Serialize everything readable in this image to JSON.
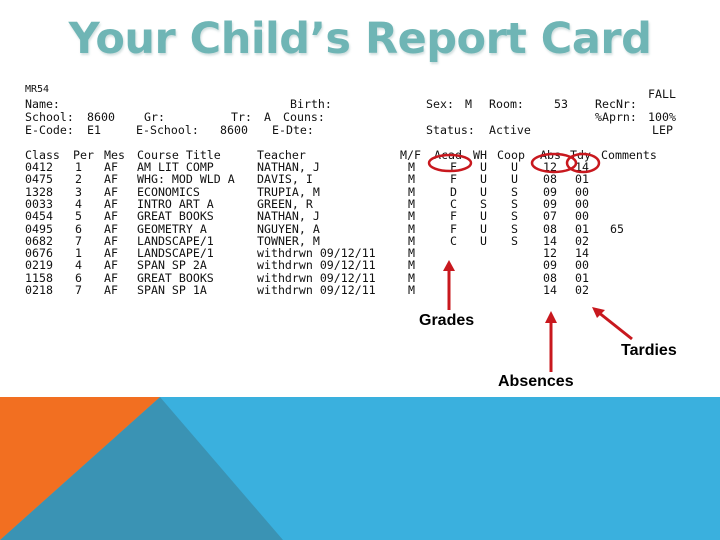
{
  "title": "Your Child’s Report Card",
  "header": {
    "record_id": "MR54",
    "term": "FALL",
    "name_label": "Name:",
    "birth_label": "Birth:",
    "sex_label": "Sex:",
    "sex_value": "M",
    "room_label": "Room:",
    "room_value": "53",
    "recnr_label": "RecNr:",
    "school_label": "School:",
    "school_value": "8600",
    "gr_label": "Gr:",
    "tr_label": "Tr:",
    "tr_value": "A",
    "couns_label": "Couns:",
    "aprn_label": "%Aprn:",
    "aprn_value": "100%",
    "ecode_label": "E-Code:",
    "ecode_value": "E1",
    "eschool_label": "E-School:",
    "eschool_value": "8600",
    "edte_label": "E-Dte:",
    "status_label": "Status:",
    "status_value": "Active",
    "lep": "LEP"
  },
  "table": {
    "columns": [
      "Class",
      "Per",
      "Mes",
      "Course Title",
      "Teacher",
      "M/F",
      "Acad",
      "WH",
      "Coop",
      "Abs",
      "Tdy",
      "Comments"
    ],
    "rows": [
      {
        "class": "0412",
        "per": "1",
        "mes": "AF",
        "course": "AM LIT COMP",
        "teacher": "NATHAN, J",
        "mf": "M",
        "acad": "F",
        "wh": "U",
        "coop": "U",
        "abs": "12",
        "tdy": "14",
        "comments": ""
      },
      {
        "class": "0475",
        "per": "2",
        "mes": "AF",
        "course": "WHG: MOD WLD A",
        "teacher": "DAVIS, I",
        "mf": "M",
        "acad": "F",
        "wh": "U",
        "coop": "U",
        "abs": "08",
        "tdy": "01",
        "comments": ""
      },
      {
        "class": "1328",
        "per": "3",
        "mes": "AF",
        "course": "ECONOMICS",
        "teacher": "TRUPIA, M",
        "mf": "M",
        "acad": "D",
        "wh": "U",
        "coop": "S",
        "abs": "09",
        "tdy": "00",
        "comments": ""
      },
      {
        "class": "0033",
        "per": "4",
        "mes": "AF",
        "course": "INTRO ART A",
        "teacher": "GREEN, R",
        "mf": "M",
        "acad": "C",
        "wh": "S",
        "coop": "S",
        "abs": "09",
        "tdy": "00",
        "comments": ""
      },
      {
        "class": "0454",
        "per": "5",
        "mes": "AF",
        "course": "GREAT BOOKS",
        "teacher": "NATHAN, J",
        "mf": "M",
        "acad": "F",
        "wh": "U",
        "coop": "S",
        "abs": "07",
        "tdy": "00",
        "comments": ""
      },
      {
        "class": "0495",
        "per": "6",
        "mes": "AF",
        "course": "GEOMETRY A",
        "teacher": "NGUYEN, A",
        "mf": "M",
        "acad": "F",
        "wh": "U",
        "coop": "S",
        "abs": "08",
        "tdy": "01",
        "comments": "65"
      },
      {
        "class": "0682",
        "per": "7",
        "mes": "AF",
        "course": "LANDSCAPE/1",
        "teacher": "TOWNER, M",
        "mf": "M",
        "acad": "C",
        "wh": "U",
        "coop": "S",
        "abs": "14",
        "tdy": "02",
        "comments": ""
      },
      {
        "class": "0676",
        "per": "1",
        "mes": "AF",
        "course": "LANDSCAPE/1",
        "teacher": "withdrwn 09/12/11",
        "mf": "M",
        "acad": "",
        "wh": "",
        "coop": "",
        "abs": "12",
        "tdy": "14",
        "comments": ""
      },
      {
        "class": "0219",
        "per": "4",
        "mes": "AF",
        "course": "SPAN SP 2A",
        "teacher": "withdrwn 09/12/11",
        "mf": "M",
        "acad": "",
        "wh": "",
        "coop": "",
        "abs": "09",
        "tdy": "00",
        "comments": ""
      },
      {
        "class": "1158",
        "per": "6",
        "mes": "AF",
        "course": "GREAT BOOKS",
        "teacher": "withdrwn 09/12/11",
        "mf": "M",
        "acad": "",
        "wh": "",
        "coop": "",
        "abs": "08",
        "tdy": "01",
        "comments": ""
      },
      {
        "class": "0218",
        "per": "7",
        "mes": "AF",
        "course": "SPAN SP 1A",
        "teacher": "withdrwn 09/12/11",
        "mf": "M",
        "acad": "",
        "wh": "",
        "coop": "",
        "abs": "14",
        "tdy": "02",
        "comments": ""
      }
    ]
  },
  "annotations": {
    "grades": "Grades",
    "absences": "Absences",
    "tardies": "Tardies"
  },
  "colors": {
    "title": "#6fb5b5",
    "annotation": "#c8181e",
    "orange": "#f26f21",
    "dark_blue": "#3a93b4",
    "light_blue": "#3ab0de"
  }
}
